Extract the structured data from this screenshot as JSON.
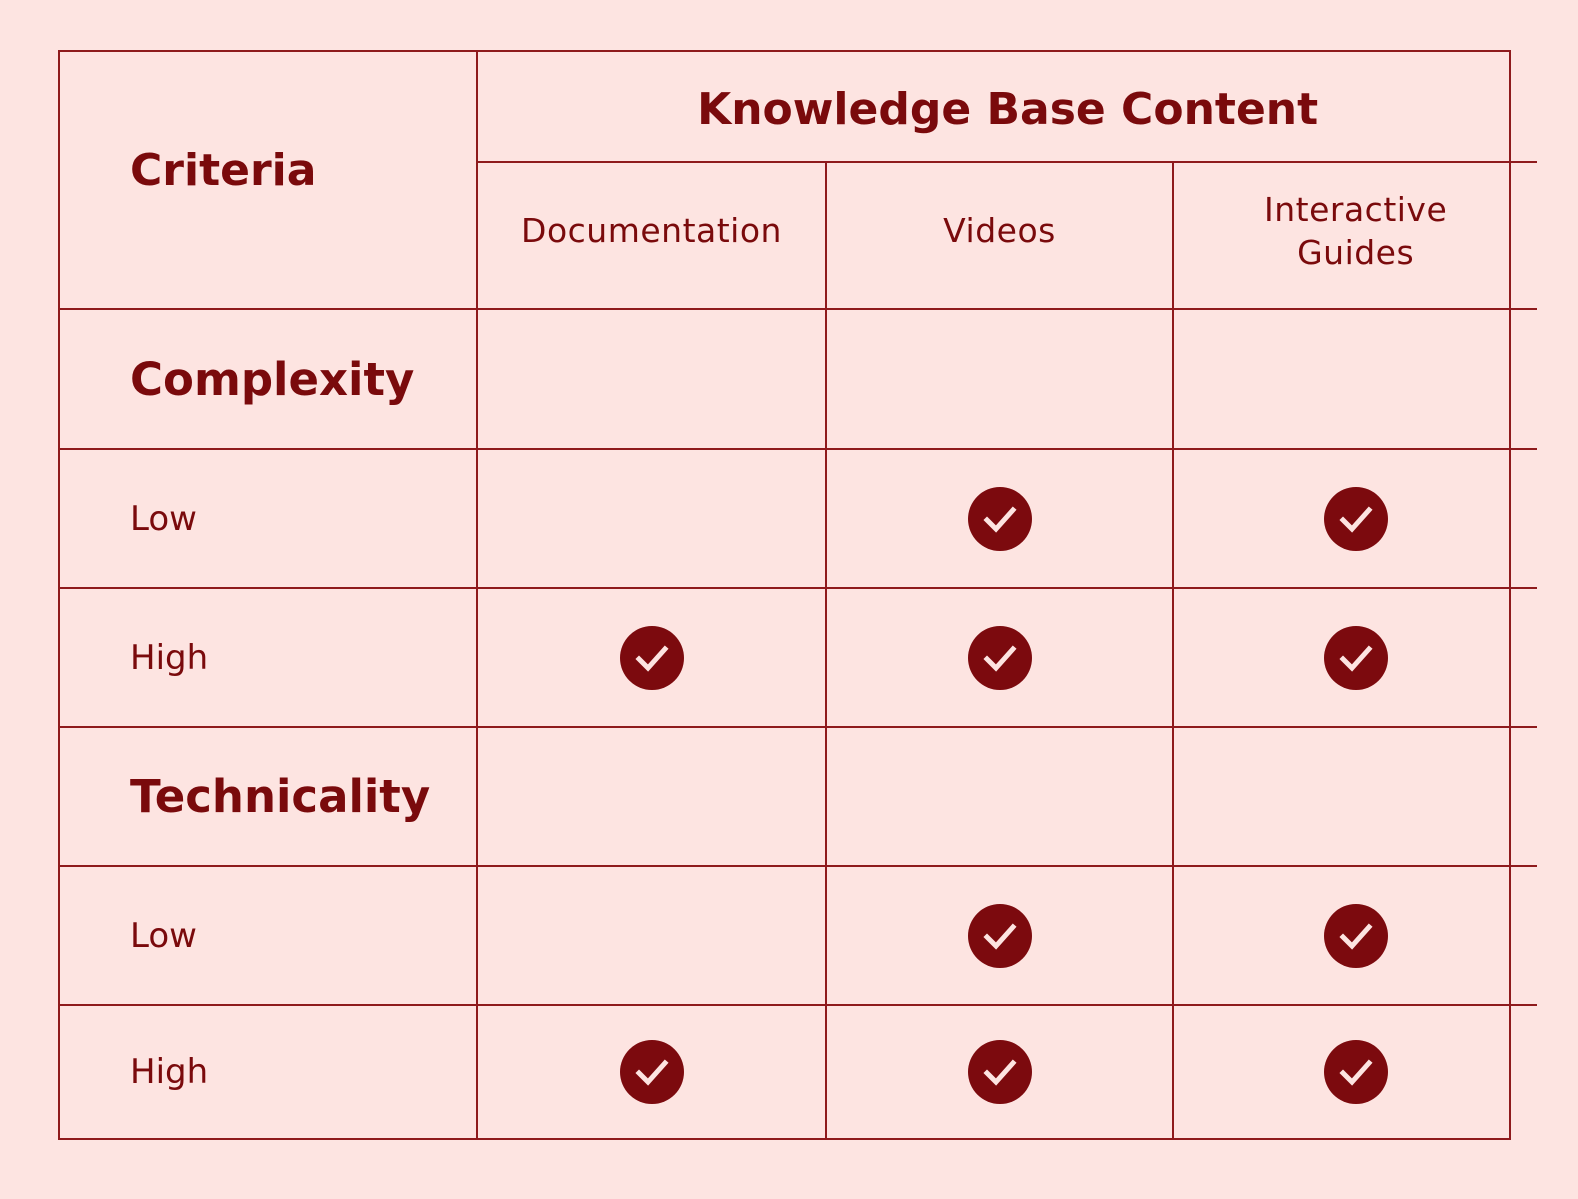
{
  "table": {
    "corner_header": "Criteria",
    "group_header": "Knowledge Base Content",
    "columns": [
      "Documentation",
      "Videos",
      "Interactive Guides"
    ],
    "check_icon": "check-circle-icon",
    "colors": {
      "background": "#fde4e1",
      "accent": "#7c0a0e",
      "border": "#8e1a1c"
    },
    "rows": [
      {
        "type": "group",
        "label": "Complexity",
        "cells": [
          false,
          false,
          false
        ]
      },
      {
        "type": "item",
        "label": "Low",
        "cells": [
          false,
          true,
          true
        ]
      },
      {
        "type": "item",
        "label": "High",
        "cells": [
          true,
          true,
          true
        ]
      },
      {
        "type": "group",
        "label": "Technicality",
        "cells": [
          false,
          false,
          false
        ]
      },
      {
        "type": "item",
        "label": "Low",
        "cells": [
          false,
          true,
          true
        ]
      },
      {
        "type": "item",
        "label": "High",
        "cells": [
          true,
          true,
          true
        ]
      }
    ]
  }
}
